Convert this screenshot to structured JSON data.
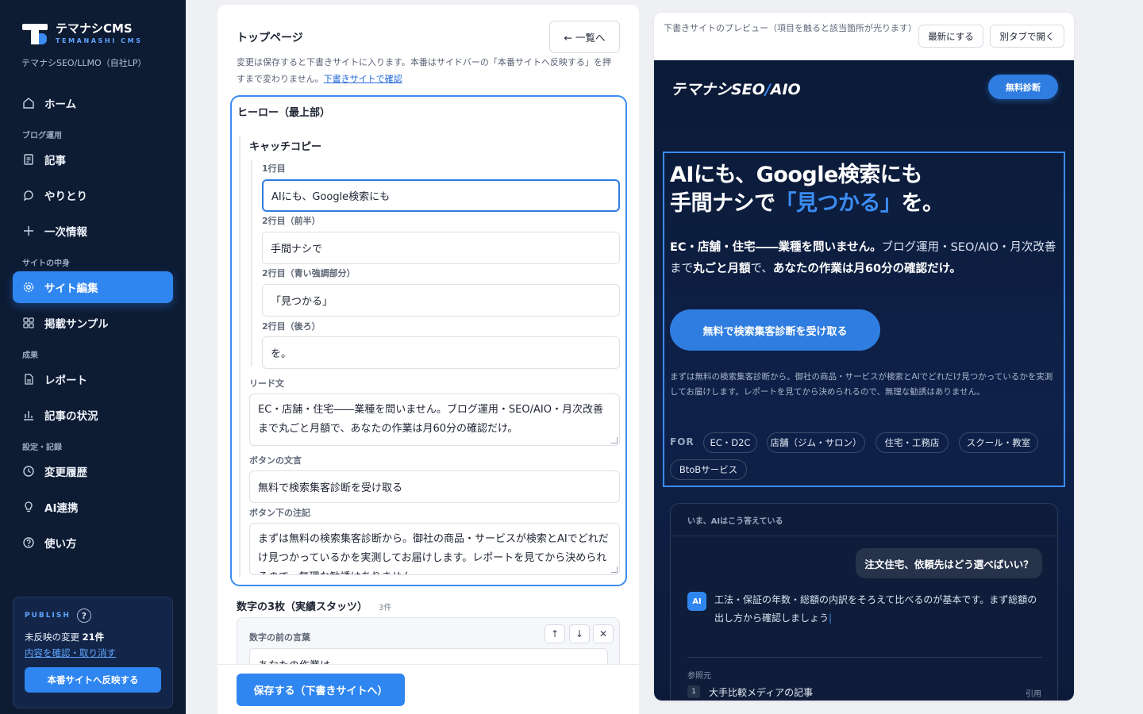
{
  "sidebar": {
    "brand_name": "テマナシCMS",
    "brand_sub": "TEMANASHI CMS",
    "site_name": "テマナシSEO/LLMO（自社LP）",
    "items": {
      "home": "ホーム",
      "section_blog": "ブログ運用",
      "articles": "記事",
      "threads": "やりとり",
      "primary_info": "一次情報",
      "section_site": "サイトの中身",
      "site_edit": "サイト編集",
      "samples": "掲載サンプル",
      "section_results": "成果",
      "report": "レポート",
      "article_status": "記事の状況",
      "section_settings": "設定・記録",
      "history": "変更履歴",
      "ai_integration": "AI連携",
      "howto": "使い方"
    },
    "publish": {
      "title": "PUBLISH",
      "help": "?",
      "unpublished_prefix": "未反映の変更",
      "unpublished_count": "21件",
      "review_link": "内容を確認・取り消す",
      "button": "本番サイトへ反映する"
    }
  },
  "editor": {
    "title": "トップページ",
    "back_button": "← 一覧へ",
    "description": "変更は保存すると下書きサイトに入ります。本番はサイドバーの「本番サイトへ反映する」を押すまで変わりません。",
    "draft_link": "下書きサイトで確認",
    "hero": {
      "title": "ヒーロー（最上部）",
      "catch_title": "キャッチコピー",
      "line1_label": "1行目",
      "line1_value": "AIにも、Google検索にも",
      "line2a_label": "2行目（前半）",
      "line2a_value": "手間ナシで",
      "line2b_label": "2行目（青い強調部分）",
      "line2b_value": "「見つかる」",
      "line2c_label": "2行目（後ろ）",
      "line2c_value": "を。",
      "lead_label": "リード文",
      "lead_value": "EC・店舗・住宅――業種を問いません。ブログ運用・SEO/AIO・月次改善まで丸ごと月額で、あなたの作業は月60分の確認だけ。",
      "button_label": "ボタンの文言",
      "button_value": "無料で検索集客診断を受け取る",
      "note_label": "ボタン下の注記",
      "note_value": "まずは無料の検索集客診断から。御社の商品・サービスが検索とAIでどれだけ見つかっているかを実測してお届けします。レポートを見てから決められるので、無理な勧誘はありません。"
    },
    "stats": {
      "title": "数字の3枚（実績スタッツ）",
      "count": "3件",
      "prefix_label": "数字の前の言葉",
      "prefix_value": "あなたの作業は",
      "up": "↑",
      "down": "↓",
      "remove": "✕"
    },
    "save_button": "保存する（下書きサイトへ）"
  },
  "preview": {
    "note": "下書きサイトのプレビュー（項目を触ると該当箇所が光ります）",
    "refresh_button": "最新にする",
    "open_tab_button": "別タブで開く",
    "site": {
      "logo_main": "テマナシSEO",
      "logo_slash": "/",
      "logo_end": "AIO",
      "header_button": "無料診断",
      "headline_line1": "AIにも、Google検索にも",
      "headline_line2a": "手間ナシで",
      "headline_line2b": "「見つかる」",
      "headline_line2c": "を。",
      "lead_bold1": "EC・店舗・住宅――業種を問いません。",
      "lead_normal1": "ブログ運用・SEO/AIO・月次改善まで",
      "lead_bold2": "丸ごと月額",
      "lead_normal2": "で、",
      "lead_bold3": "あなたの作業は月60分の確認だけ。",
      "cta": "無料で検索集客診断を受け取る",
      "note": "まずは無料の検索集客診断から。御社の商品・サービスが検索とAIでどれだけ見つかっているかを実測してお届けします。レポートを見てから決められるので、無理な勧誘はありません。",
      "for_label": "FOR",
      "chips": [
        "EC・D2C",
        "店舗（ジム・サロン）",
        "住宅・工務店",
        "スクール・教室",
        "BtoBサービス"
      ],
      "ai_card": {
        "title": "いま、AIはこう答えている",
        "question": "注文住宅、依頼先はどう選べばいい？",
        "badge": "AI",
        "answer": "工法・保証の年数・総額の内訳をそろえて比べるのが基本です。まず総額の出し方から確認しましょう",
        "cursor": "|",
        "ref_label": "参照元",
        "ref_num": "1",
        "ref_title": "大手比較メディアの記事",
        "ref_tag": "引用"
      }
    }
  },
  "colors": {
    "sidebar_bg": "#0d1b33",
    "accent": "#2f86f0",
    "site_bg": "#0b1a36",
    "highlight_border": "#3a8df0"
  }
}
